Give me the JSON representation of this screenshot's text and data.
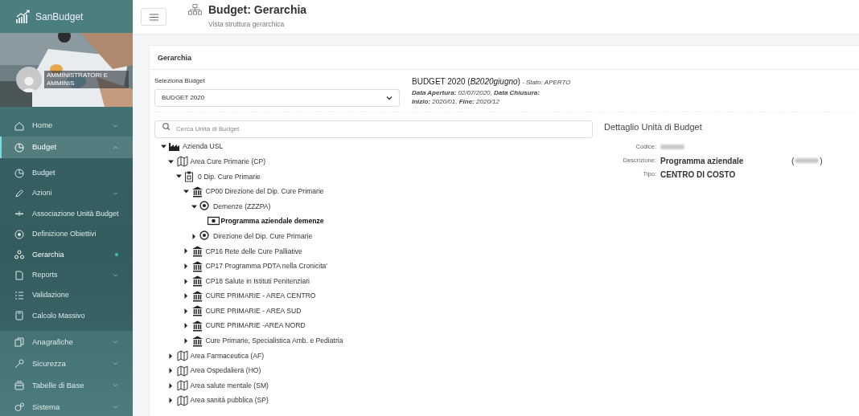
{
  "brand": {
    "name": "SanBudget"
  },
  "user": {
    "role": "AMMINISTRATORI E AMMINIS"
  },
  "sidebar": {
    "items": [
      {
        "label": "Home",
        "expanded": false,
        "selected": false
      },
      {
        "label": "Budget",
        "expanded": true,
        "selected": true,
        "children": [
          {
            "label": "Budget",
            "selected": false
          },
          {
            "label": "Azioni",
            "expanded": false,
            "selected": false
          },
          {
            "label": "Associazione Unità Budget",
            "selected": false
          },
          {
            "label": "Definizione Obiettivi",
            "selected": false
          },
          {
            "label": "Gerarchia",
            "selected": true
          },
          {
            "label": "Reports",
            "expanded": false,
            "selected": false
          },
          {
            "label": "Validazione",
            "selected": false
          },
          {
            "label": "Calcolo Massivo",
            "selected": false
          }
        ]
      },
      {
        "label": "Anagrafiche",
        "expanded": false,
        "selected": false
      },
      {
        "label": "Sicurezza",
        "expanded": false,
        "selected": false
      },
      {
        "label": "Tabelle di Base",
        "expanded": false,
        "selected": false
      },
      {
        "label": "Sistema",
        "expanded": false,
        "selected": false
      }
    ]
  },
  "header": {
    "title": "Budget: Gerarchia",
    "subtitle": "Vista struttura gerarchica"
  },
  "card": {
    "title": "Gerarchia",
    "budget_select": {
      "label": "Seleziona Budget",
      "value": "BUDGET 2020"
    },
    "budget_info": {
      "name": "BUDGET 2020 (",
      "code": "B2020giugno",
      "close": ")",
      "state_label": "- Stato:",
      "state": "APERTO",
      "line2": [
        {
          "k": "Data Apertura:",
          "v": " 02/07/2020, "
        },
        {
          "k": "Data Chiusura:"
        }
      ],
      "line3": [
        {
          "k": "Inizio:",
          "v": " 2020/01, "
        },
        {
          "k": "Fine:",
          "v": " 2020/12"
        }
      ]
    },
    "search": {
      "placeholder": "Cerca Unità di Budget"
    },
    "tree": [
      {
        "label": "Azienda USL",
        "kind": "company",
        "expanded": true,
        "selected": false,
        "children": [
          {
            "label": "Area Cure Primarie (CP)",
            "kind": "map",
            "expanded": true,
            "selected": false,
            "children": [
              {
                "label": "0 Dip. Cure Primarie",
                "kind": "clipboard",
                "expanded": true,
                "selected": false,
                "children": [
                  {
                    "label": "CP00 Direzione del Dip. Cure Primarie",
                    "kind": "bank",
                    "expanded": true,
                    "selected": false,
                    "children": [
                      {
                        "label": "Demenze (ZZZPA)",
                        "kind": "target",
                        "expanded": true,
                        "selected": false,
                        "children": [
                          {
                            "label": "Programma aziendale demenze",
                            "kind": "money",
                            "selected": true
                          }
                        ]
                      },
                      {
                        "label": "Direzione del Dip. Cure Primarie",
                        "kind": "target",
                        "expanded": false,
                        "selected": false
                      }
                    ]
                  },
                  {
                    "label": "CP16 Rete delle Cure Palliative",
                    "kind": "bank",
                    "expanded": false,
                    "selected": false
                  },
                  {
                    "label": "CP17 Programma PDTA nella Cronicita'",
                    "kind": "bank",
                    "expanded": false,
                    "selected": false
                  },
                  {
                    "label": "CP18 Salute in Istituti Penitenziari",
                    "kind": "bank",
                    "expanded": false,
                    "selected": false
                  },
                  {
                    "label": "CURE PRIMARIE  - AREA CENTRO",
                    "kind": "bank",
                    "expanded": false,
                    "selected": false
                  },
                  {
                    "label": "CURE PRIMARIE  - AREA SUD",
                    "kind": "bank",
                    "expanded": false,
                    "selected": false
                  },
                  {
                    "label": "CURE PRIMARIE  -AREA NORD",
                    "kind": "bank",
                    "expanded": false,
                    "selected": false
                  },
                  {
                    "label": "Cure Primarie, Specialistica Amb. e Pediatria",
                    "kind": "bank",
                    "expanded": false,
                    "selected": false
                  }
                ]
              }
            ]
          },
          {
            "label": "Area Farmaceutica (AF)",
            "kind": "map",
            "expanded": false,
            "selected": false
          },
          {
            "label": "Area Ospedaliera (HO)",
            "kind": "map",
            "expanded": false,
            "selected": false
          },
          {
            "label": "Area salute mentale (SM)",
            "kind": "map",
            "expanded": false,
            "selected": false
          },
          {
            "label": "Area sanità pubblica (SP)",
            "kind": "map",
            "expanded": false,
            "selected": false
          }
        ]
      }
    ],
    "detail": {
      "title": "Dettaglio Unità di Budget",
      "fields": [
        {
          "label": "Codice:",
          "kind": "hidden"
        },
        {
          "label": "Descrizione:",
          "kind": "text_code",
          "value": "Programma aziendale",
          "open": "(",
          "close": ")"
        },
        {
          "label": "Tipo:",
          "kind": "text",
          "value": "CENTRO DI COSTO"
        }
      ]
    }
  }
}
